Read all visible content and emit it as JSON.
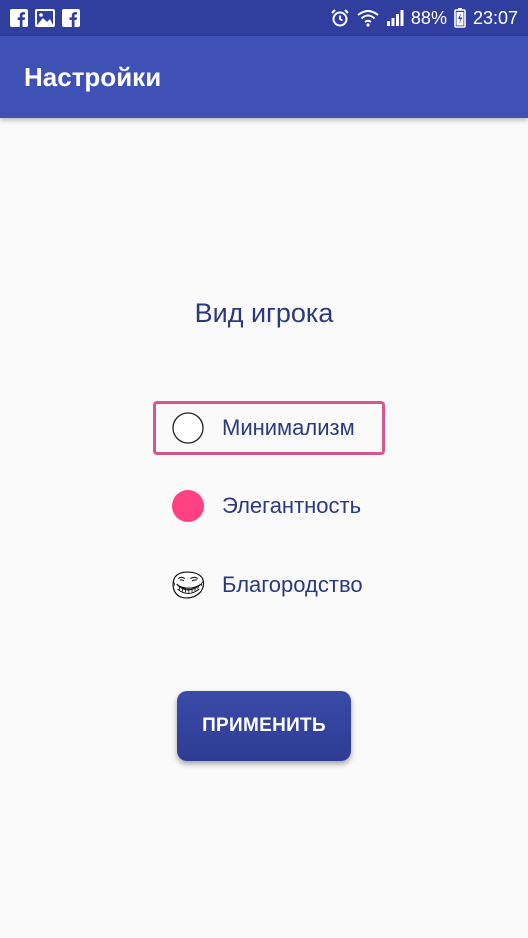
{
  "status_bar": {
    "left_icons": [
      "facebook-icon",
      "gallery-icon",
      "facebook-icon"
    ],
    "right_icons": [
      "alarm-icon",
      "wifi-icon",
      "signal-icon",
      "battery-icon"
    ],
    "battery": "88%",
    "time": "23:07"
  },
  "app_bar": {
    "title": "Настройки",
    "color": "#3f51b5"
  },
  "main": {
    "section_title": "Вид игрока",
    "options": [
      {
        "label": "Минимализм",
        "icon": "empty-circle-icon",
        "focused": true
      },
      {
        "label": "Элегантность",
        "icon": "pink-dot-icon",
        "color": "#ff4081"
      },
      {
        "label": "Благородство",
        "icon": "trollface-icon"
      }
    ],
    "apply_button": "ПРИМЕНИТЬ"
  },
  "colors": {
    "status_bar": "#303f9f",
    "accent": "#ff4081",
    "text": "#2b3a7e",
    "focus_border": "#d6578c"
  }
}
